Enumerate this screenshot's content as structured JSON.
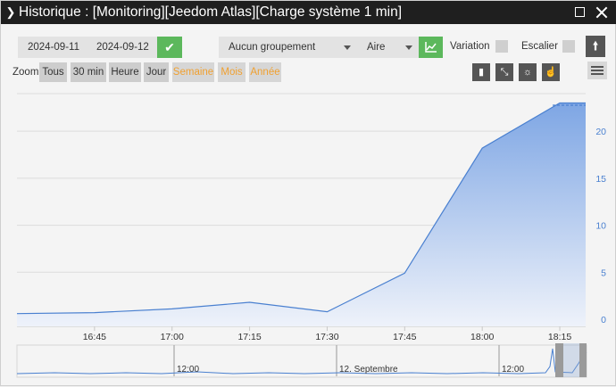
{
  "window": {
    "title": "Historique : [Monitoring][Jeedom Atlas][Charge système 1 min]"
  },
  "controls": {
    "start_date": "2024-09-11",
    "end_date": "2024-09-12",
    "grouping": "Aucun groupement",
    "chart_type": "Aire",
    "variation_label": "Variation",
    "stairs_label": "Escalier"
  },
  "zoom": {
    "label": "Zoom",
    "buttons": [
      "Tous",
      "30 min",
      "Heure",
      "Jour",
      "Semaine",
      "Mois",
      "Année"
    ]
  },
  "icons": {
    "collapse": "chevron-right-icon",
    "maximize": "maximize-icon",
    "close": "close-icon",
    "confirm": "check-icon",
    "chart": "area-chart-icon",
    "up": "arrow-up-icon",
    "menu": "hamburger-icon"
  },
  "colors": {
    "confirm_button": "#5cb85c",
    "series": "#4a80d0",
    "zoom_disabled_text": "#f0a030"
  },
  "chart_data": {
    "type": "area",
    "x": [
      "16:30",
      "16:45",
      "17:00",
      "17:15",
      "17:30",
      "17:45",
      "18:00",
      "18:15",
      "18:20"
    ],
    "values": [
      0.6,
      0.7,
      1.1,
      1.8,
      0.8,
      4.9,
      18.2,
      23.0,
      23.0
    ],
    "xticks": [
      "16:45",
      "17:00",
      "17:15",
      "17:30",
      "17:45",
      "18:00",
      "18:15"
    ],
    "yticks": [
      "0",
      "5",
      "10",
      "15",
      "20"
    ],
    "ylim": [
      0,
      24
    ],
    "grid": true,
    "navigator_labels": [
      "12:00",
      "12. Septembre",
      "12:00"
    ]
  }
}
